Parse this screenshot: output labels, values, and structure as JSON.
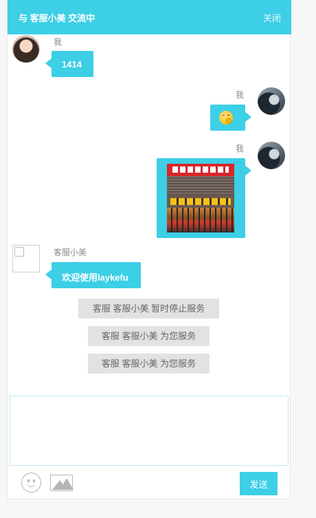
{
  "header": {
    "title": "与 客服小美 交流中",
    "close_label": "关闭"
  },
  "messages": [
    {
      "sender": "我",
      "side": "left",
      "avatar": "avatar-girl",
      "text": "1414"
    },
    {
      "sender": "我",
      "side": "right",
      "avatar": "avatar-dark",
      "content": "emoji"
    },
    {
      "sender": "我",
      "side": "right",
      "avatar": "avatar-dark",
      "content": "image"
    },
    {
      "sender": "客服小美",
      "side": "left",
      "avatar": "broken-image",
      "text": "欢迎使用laykefu"
    }
  ],
  "system_messages": [
    "客服 客服小美 暂时停止服务",
    "客服 客服小美 为您服务",
    "客服 客服小美 为您服务"
  ],
  "input": {
    "value": "",
    "placeholder": ""
  },
  "toolbar": {
    "emoji_icon": "smiley-icon",
    "image_icon": "image-icon",
    "send_label": "发送"
  },
  "colors": {
    "accent": "#3ccfe6",
    "system_bg": "#e2e2e2",
    "name_text": "#8a8a8a"
  }
}
